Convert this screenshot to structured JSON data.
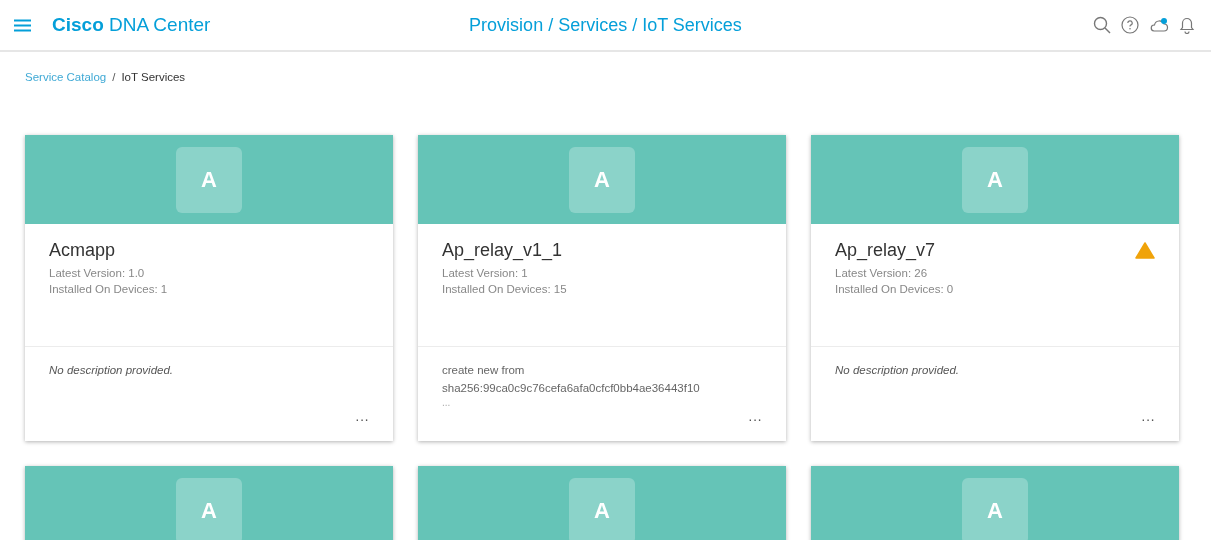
{
  "header": {
    "brand_bold": "Cisco",
    "brand_rest": "DNA Center",
    "page_title": "Provision / Services / IoT Services",
    "cloud_notification": true
  },
  "breadcrumb": {
    "separator": "/",
    "items": [
      {
        "label": "Service Catalog",
        "link": true
      },
      {
        "label": "IoT Services",
        "link": false
      }
    ]
  },
  "cards": [
    {
      "avatar": "A",
      "name": "Acmapp",
      "version": "Latest Version: 1.0",
      "devices": "Installed On Devices: 1",
      "warning": false,
      "description": {
        "kind": "empty",
        "lines": [
          "No description provided."
        ]
      },
      "menu": "···"
    },
    {
      "avatar": "A",
      "name": "Ap_relay_v1_1",
      "version": "Latest Version: 1",
      "devices": "Installed On Devices: 15",
      "warning": false,
      "description": {
        "kind": "text",
        "lines": [
          "create new from",
          "sha256:99ca0c9c76cefa6afa0cfcf0bb4ae36443f10"
        ],
        "more": "..."
      },
      "menu": "···"
    },
    {
      "avatar": "A",
      "name": "Ap_relay_v7",
      "version": "Latest Version: 26",
      "devices": "Installed On Devices: 0",
      "warning": true,
      "description": {
        "kind": "empty",
        "lines": [
          "No description provided."
        ]
      },
      "menu": "···"
    },
    {
      "avatar": "A"
    },
    {
      "avatar": "A"
    },
    {
      "avatar": "A"
    }
  ]
}
